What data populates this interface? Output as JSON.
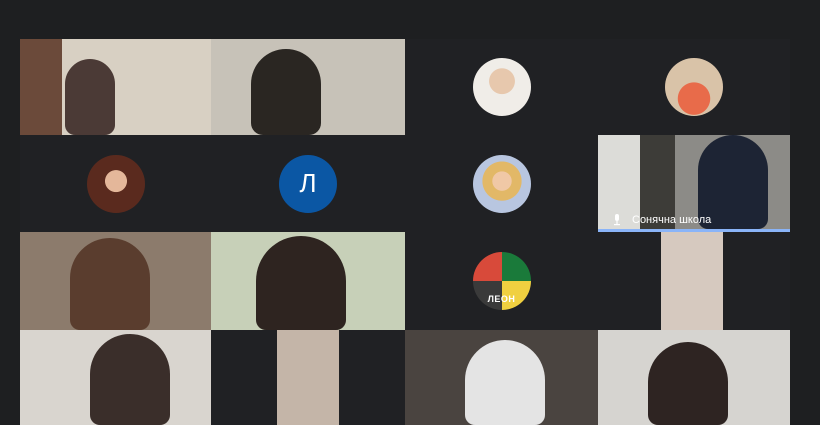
{
  "meeting": {
    "participants": [
      {
        "id": "p1",
        "kind": "video"
      },
      {
        "id": "p2",
        "kind": "video"
      },
      {
        "id": "p3",
        "kind": "avatar-photo"
      },
      {
        "id": "p4",
        "kind": "avatar-photo"
      },
      {
        "id": "p5",
        "kind": "avatar-photo"
      },
      {
        "id": "p6",
        "kind": "avatar-letter",
        "initial": "Л",
        "color": "#0b57a4"
      },
      {
        "id": "p7",
        "kind": "avatar-photo"
      },
      {
        "id": "p8",
        "kind": "video",
        "name": "Сонячна школа",
        "speaking": true
      },
      {
        "id": "p9",
        "kind": "video"
      },
      {
        "id": "p10",
        "kind": "video"
      },
      {
        "id": "p11",
        "kind": "avatar-logo",
        "logo_text": "ЛЕОН"
      },
      {
        "id": "p12",
        "kind": "video"
      },
      {
        "id": "p13",
        "kind": "video"
      },
      {
        "id": "p14",
        "kind": "video"
      },
      {
        "id": "p15",
        "kind": "video"
      },
      {
        "id": "p16",
        "kind": "video"
      }
    ]
  },
  "colors": {
    "background": "#1e1f21",
    "tile": "#202124",
    "speaking_highlight": "#8ab4f8"
  }
}
